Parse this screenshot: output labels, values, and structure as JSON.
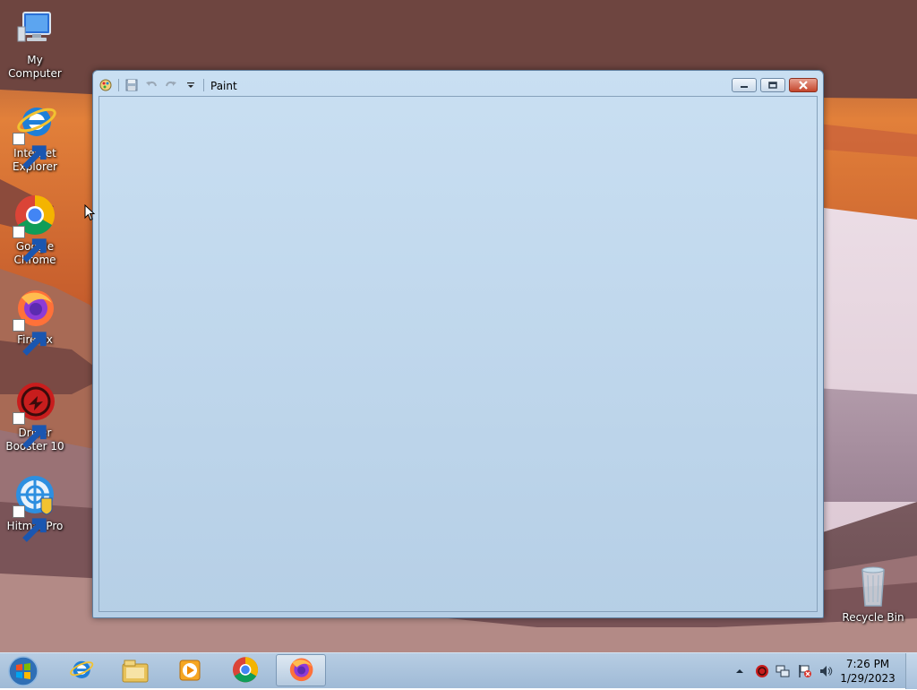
{
  "desktop": {
    "icons": [
      {
        "label": "My Computer",
        "icon": "computer-icon"
      },
      {
        "label": "Internet Explorer",
        "icon": "internet-explorer-icon"
      },
      {
        "label": "Google Chrome",
        "icon": "chrome-icon"
      },
      {
        "label": "Firefox",
        "icon": "firefox-icon"
      },
      {
        "label": "Driver Booster 10",
        "icon": "driver-booster-icon"
      },
      {
        "label": "HitmanPro",
        "icon": "hitmanpro-icon"
      },
      {
        "label": "Recycle Bin",
        "icon": "recycle-bin-icon"
      }
    ]
  },
  "window": {
    "title": "Paint",
    "quick_access": [
      "paint-app-icon",
      "save-icon",
      "undo-icon",
      "redo-icon",
      "customize-dropdown-icon"
    ],
    "caption_buttons": [
      "minimize",
      "restore",
      "close"
    ]
  },
  "taskbar": {
    "pinned": [
      "start-orb-icon",
      "internet-explorer-icon",
      "file-explorer-icon",
      "media-player-icon",
      "chrome-icon",
      "firefox-icon"
    ],
    "active": "firefox-icon",
    "tray": [
      "show-hidden-icons-chevron",
      "driver-booster-tray-icon",
      "network-icon",
      "action-center-flag-icon",
      "volume-icon"
    ],
    "time": "7:26 PM",
    "date": "1/29/2023"
  },
  "colors": {
    "taskbar": "#a8c2dd",
    "window_frame": "#c1d7ec",
    "close_button": "#c4452c"
  }
}
